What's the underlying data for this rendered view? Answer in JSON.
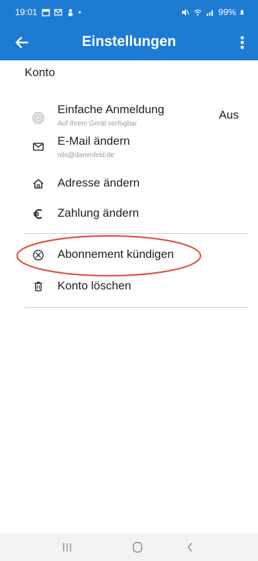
{
  "status_bar": {
    "time": "19:01",
    "battery": "99%"
  },
  "app_bar": {
    "title": "Einstellungen",
    "back_icon": "arrow-left-icon",
    "menu_icon": "more-vertical-icon"
  },
  "section": {
    "title": "Konto"
  },
  "items": [
    {
      "label": "Einfache Anmeldung",
      "sub": "Auf Ihrem Gerät verfügbar",
      "value": "Aus",
      "icon": "fingerprint-icon"
    },
    {
      "label": "E-Mail ändern",
      "sub": "nils@dammfeld.de",
      "icon": "mail-icon"
    },
    {
      "label": "Adresse ändern",
      "icon": "home-icon"
    },
    {
      "label": "Zahlung ändern",
      "icon": "euro-icon"
    }
  ],
  "items2": [
    {
      "label": "Abonnement kündigen",
      "icon": "cancel-circle-icon"
    },
    {
      "label": "Konto löschen",
      "icon": "trash-icon"
    }
  ],
  "colors": {
    "primary": "#1e7bd4",
    "highlight": "#e0523f"
  },
  "nav": {
    "recent_icon": "recent-apps-icon",
    "home_icon": "home-circle-icon",
    "back_icon": "back-chevron-icon"
  }
}
